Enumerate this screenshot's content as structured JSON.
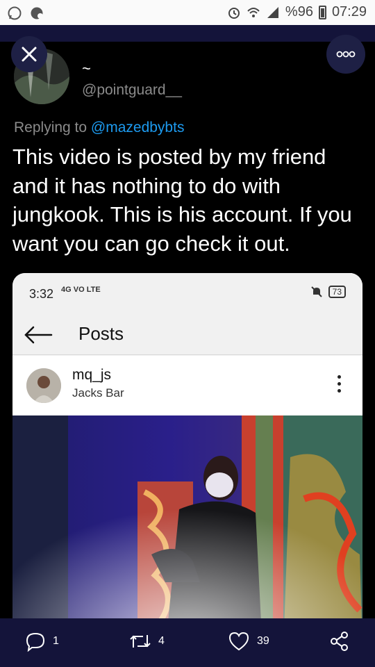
{
  "statusbar": {
    "battery_pct": "%96",
    "time": "07:29"
  },
  "tweet": {
    "display_name": "~",
    "handle": "@pointguard__",
    "reply_prefix": "Replying to",
    "reply_to": "@mazedbybts",
    "text": "This video is posted by my friend and it has nothing to do with jungkook. This is his account. If you want you can go check it out."
  },
  "embedded": {
    "status_time": "3:32",
    "signal_label": "4G",
    "volte_label": "VO LTE",
    "battery": "73",
    "header_title": "Posts",
    "post_user": "mq_js",
    "post_location": "Jacks Bar"
  },
  "actions": {
    "replies": "1",
    "retweets": "4",
    "likes": "39"
  },
  "colors": {
    "accent": "#1d9bf0",
    "band": "#14143a"
  }
}
